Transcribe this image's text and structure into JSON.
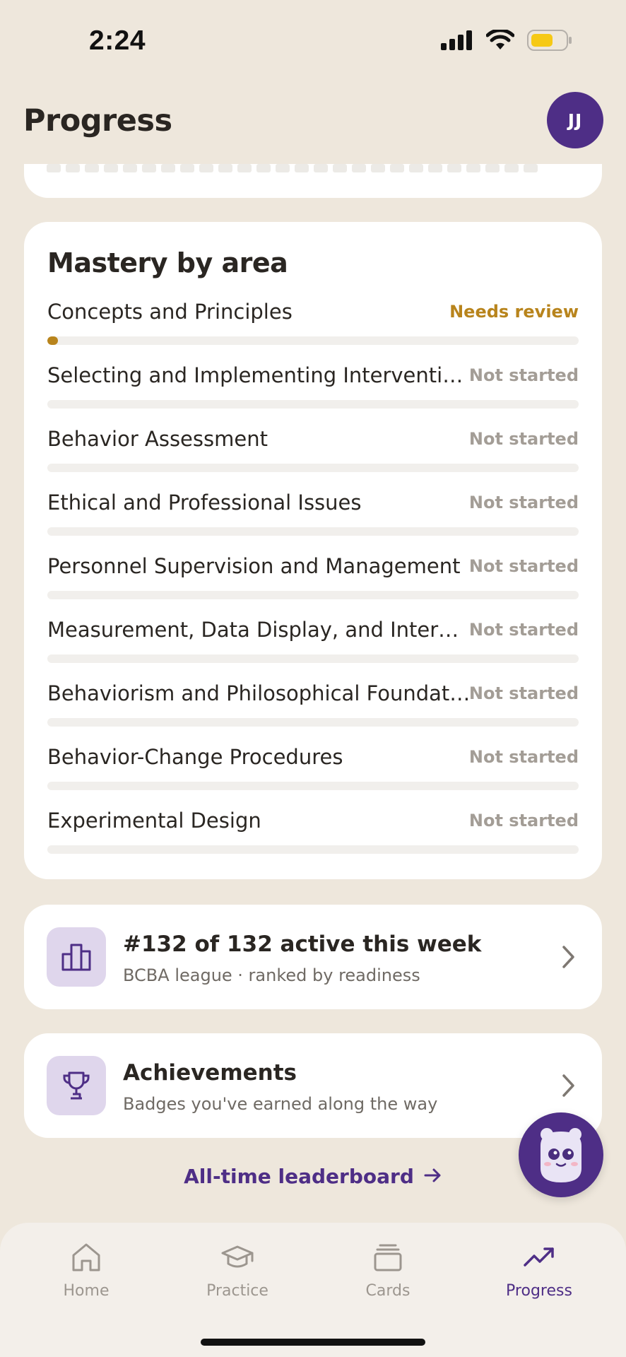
{
  "status_bar": {
    "time": "2:24"
  },
  "header": {
    "title": "Progress",
    "avatar_initials": "JJ"
  },
  "mastery": {
    "title": "Mastery by area",
    "areas": [
      {
        "name": "Concepts and Principles",
        "status": "Needs review",
        "progress": 0.02
      },
      {
        "name": "Selecting and Implementing Interventions",
        "status": "Not started",
        "progress": 0
      },
      {
        "name": "Behavior Assessment",
        "status": "Not started",
        "progress": 0
      },
      {
        "name": "Ethical and Professional Issues",
        "status": "Not started",
        "progress": 0
      },
      {
        "name": "Personnel Supervision and Management",
        "status": "Not started",
        "progress": 0
      },
      {
        "name": "Measurement, Data Display, and Interpr...",
        "status": "Not started",
        "progress": 0
      },
      {
        "name": "Behaviorism and Philosophical Foundati...",
        "status": "Not started",
        "progress": 0
      },
      {
        "name": "Behavior-Change Procedures",
        "status": "Not started",
        "progress": 0
      },
      {
        "name": "Experimental Design",
        "status": "Not started",
        "progress": 0
      }
    ]
  },
  "league": {
    "title": "#132 of 132 active this week",
    "subtitle": "BCBA league · ranked by readiness"
  },
  "achievements": {
    "title": "Achievements",
    "subtitle": "Badges you've earned along the way"
  },
  "all_time_link": "All-time leaderboard",
  "tabs": [
    {
      "label": "Home",
      "icon": "home-icon"
    },
    {
      "label": "Practice",
      "icon": "graduation-cap-icon"
    },
    {
      "label": "Cards",
      "icon": "cards-icon"
    },
    {
      "label": "Progress",
      "icon": "trending-up-icon",
      "active": true
    }
  ],
  "colors": {
    "accent": "#4E2E86",
    "review": "#B8841C",
    "background": "#EEE7DC"
  }
}
